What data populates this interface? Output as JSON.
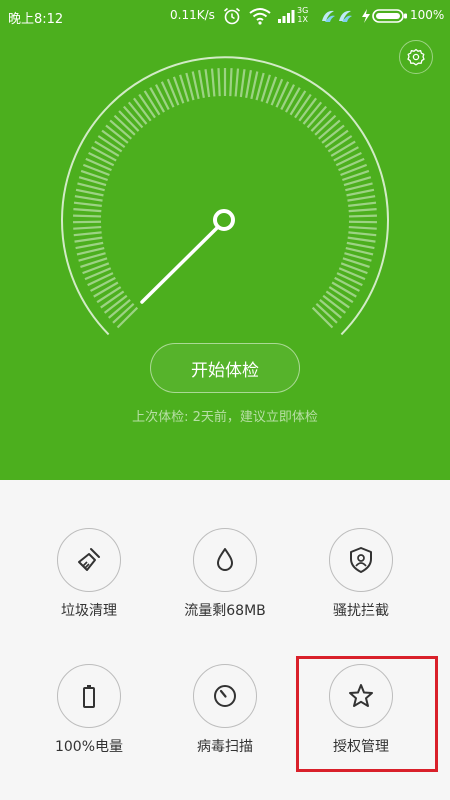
{
  "status": {
    "time": "晚上8:12",
    "speed": "0.11K/s",
    "network": "3G",
    "network_sub": "1X",
    "battery": "100%"
  },
  "header": {
    "start_label": "开始体检",
    "last_check": "上次体检: 2天前，建议立即体检"
  },
  "tiles": [
    {
      "label": "垃圾清理",
      "icon": "broom-icon"
    },
    {
      "label": "流量剩68MB",
      "icon": "drop-icon"
    },
    {
      "label": "骚扰拦截",
      "icon": "shield-user-icon"
    },
    {
      "label": "100%电量",
      "icon": "battery-icon"
    },
    {
      "label": "病毒扫描",
      "icon": "scan-dial-icon"
    },
    {
      "label": "授权管理",
      "icon": "star-icon"
    }
  ],
  "colors": {
    "accent": "#4caf1e",
    "highlight": "#d9202a"
  }
}
